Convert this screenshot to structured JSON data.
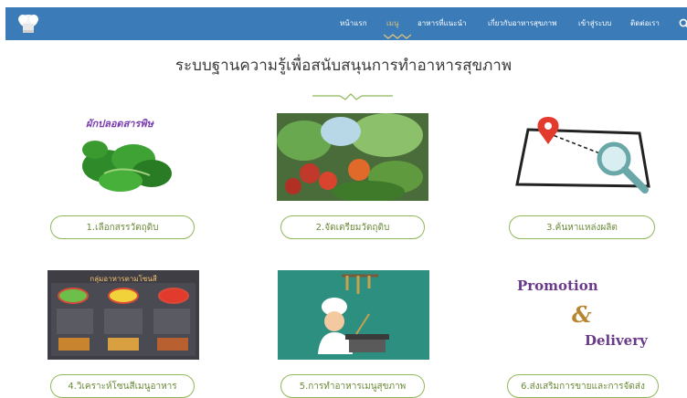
{
  "nav": {
    "logo_icon": "chef-hat-icon",
    "items": [
      {
        "label": "หน้าแรก",
        "active": false
      },
      {
        "label": "เมนู",
        "active": true
      },
      {
        "label": "อาหารที่แนะนำ",
        "active": false
      },
      {
        "label": "เกี่ยวกับอาหารสุขภาพ",
        "active": false
      },
      {
        "label": "เข้าสู่ระบบ",
        "active": false
      },
      {
        "label": "ติดต่อเรา",
        "active": false
      }
    ],
    "search_icon": "search-icon"
  },
  "page": {
    "title": "ระบบฐานความรู้เพื่อสนับสนุนการทำอาหารสุขภาพ"
  },
  "cards": [
    {
      "label": "1.เลือกสรรวัตถุดิบ",
      "image_text": "ผักปลอดสารพิษ"
    },
    {
      "label": "2.จัดเตรียมวัตถุดิบ"
    },
    {
      "label": "3.ค้นหาแหล่งผลิต"
    },
    {
      "label": "4.วิเคราะห์โซนสีเมนูอาหาร",
      "image_text": "กลุ่มอาหารตามโซนสี"
    },
    {
      "label": "5.การทำอาหารเมนูสุขภาพ"
    },
    {
      "label": "6.ส่งเสริมการขายและการจัดส่ง",
      "promo_text": [
        "Promotion",
        "&",
        "Delivery"
      ]
    }
  ],
  "colors": {
    "nav_bg": "#3a7bb8",
    "accent": "#d9c27c",
    "pill_border": "#8fb75a",
    "pill_text": "#6b8b3a"
  }
}
